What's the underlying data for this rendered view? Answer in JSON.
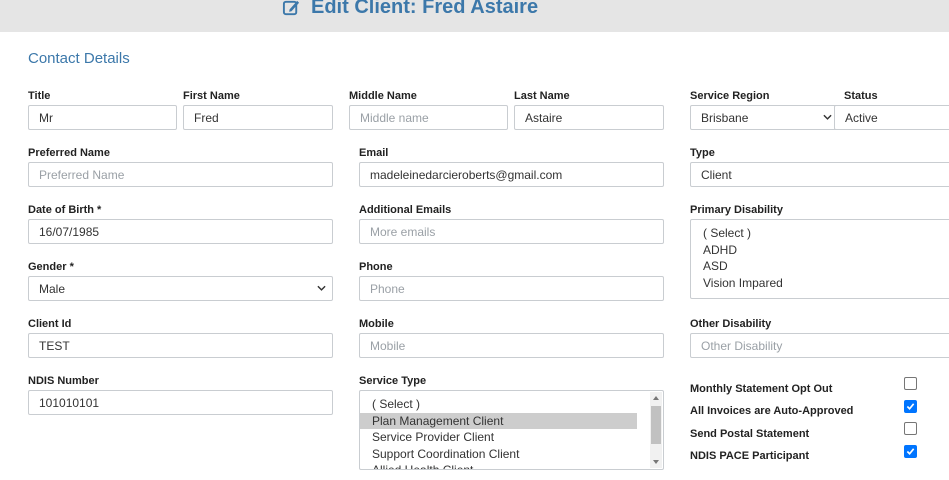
{
  "header": {
    "title": "Edit Client: Fred Astaire",
    "icon": "edit-icon"
  },
  "section_title": "Contact Details",
  "labels": {
    "title": "Title",
    "first_name": "First Name",
    "middle_name": "Middle Name",
    "last_name": "Last Name",
    "service_region": "Service Region",
    "status": "Status",
    "preferred_name": "Preferred Name",
    "email": "Email",
    "type": "Type",
    "dob": "Date of Birth *",
    "additional_emails": "Additional Emails",
    "primary_disability": "Primary Disability",
    "gender": "Gender *",
    "phone": "Phone",
    "client_id": "Client Id",
    "mobile": "Mobile",
    "other_disability": "Other Disability",
    "ndis_number": "NDIS Number",
    "service_type": "Service Type"
  },
  "fields": {
    "title": {
      "value": "Mr"
    },
    "first_name": {
      "value": "Fred"
    },
    "middle_name": {
      "value": "",
      "placeholder": "Middle name"
    },
    "last_name": {
      "value": "Astaire"
    },
    "service_region": {
      "value": "Brisbane"
    },
    "status": {
      "value": "Active"
    },
    "preferred_name": {
      "value": "",
      "placeholder": "Preferred Name"
    },
    "email": {
      "value": "madeleinedarcieroberts@gmail.com"
    },
    "type": {
      "value": "Client"
    },
    "dob": {
      "value": "16/07/1985"
    },
    "additional_emails": {
      "value": "",
      "placeholder": "More emails"
    },
    "gender": {
      "value": "Male"
    },
    "phone": {
      "value": "",
      "placeholder": "Phone"
    },
    "client_id": {
      "value": "TEST"
    },
    "mobile": {
      "value": "",
      "placeholder": "Mobile"
    },
    "other_disability": {
      "value": "",
      "placeholder": "Other Disability"
    },
    "ndis_number": {
      "value": "101010101"
    }
  },
  "primary_disability_options": [
    "( Select )",
    "ADHD",
    "ASD",
    "Vision Impared"
  ],
  "service_type_options": [
    "( Select )",
    "Plan Management Client",
    "Service Provider Client",
    "Support Coordination Client",
    "Allied Health Client"
  ],
  "service_type_selected": "Plan Management Client",
  "checkboxes": [
    {
      "label": "Monthly Statement Opt Out",
      "checked": false
    },
    {
      "label": "All Invoices are Auto-Approved",
      "checked": true
    },
    {
      "label": "Send Postal Statement",
      "checked": false
    },
    {
      "label": "NDIS PACE Participant",
      "checked": true
    }
  ],
  "colors": {
    "accent": "#3c78aa",
    "checkbox": "#0075ff",
    "header_bg": "#e5e5e5"
  }
}
